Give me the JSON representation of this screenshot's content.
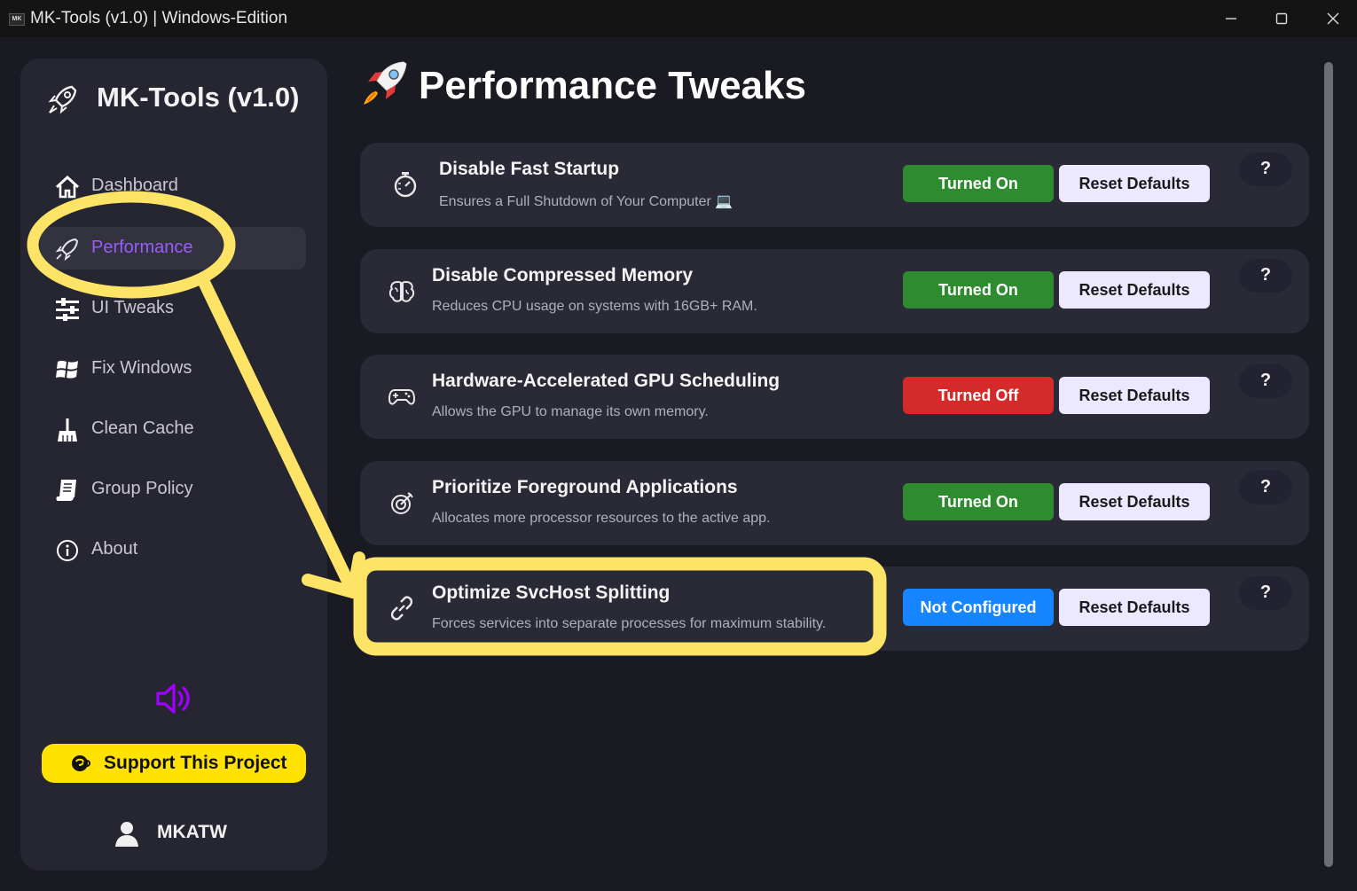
{
  "window": {
    "app_icon": "MK",
    "title": "MK-Tools (v1.0) | Windows-Edition",
    "icons": {
      "minimize": "minimize-icon",
      "maximize": "maximize-icon",
      "close": "close-icon"
    }
  },
  "sidebar": {
    "brand_icon": "rocket-icon",
    "brand": "MK-Tools (v1.0)",
    "items": [
      {
        "label": "Dashboard",
        "icon": "home-icon"
      },
      {
        "label": "Performance",
        "icon": "rocket-icon",
        "active": true
      },
      {
        "label": "UI Tweaks",
        "icon": "sliders-icon"
      },
      {
        "label": "Fix Windows",
        "icon": "windows-logo-icon"
      },
      {
        "label": "Clean Cache",
        "icon": "broom-icon"
      },
      {
        "label": "Group Policy",
        "icon": "scroll-icon"
      },
      {
        "label": "About",
        "icon": "info-icon"
      }
    ],
    "sound_icon": "speaker-icon",
    "support_label": "Support This Project",
    "support_icon": "coffee-icon",
    "user_icon": "user-icon",
    "user": "MKATW"
  },
  "main": {
    "page_icon": "rocket-icon",
    "title": "Performance Tweaks",
    "tweaks": [
      {
        "title": "Disable Fast Startup",
        "desc": "Ensures a Full Shutdown of Your Computer 💻",
        "status": "Turned On",
        "state": "on",
        "reset": "Reset Defaults",
        "help": "?",
        "icon": "stopwatch-icon"
      },
      {
        "title": "Disable Compressed Memory",
        "desc": "Reduces CPU usage on systems with 16GB+ RAM.",
        "status": "Turned On",
        "state": "on",
        "reset": "Reset Defaults",
        "help": "?",
        "icon": "brain-icon"
      },
      {
        "title": "Hardware-Accelerated GPU Scheduling",
        "desc": "Allows the GPU to manage its own memory.",
        "status": "Turned Off",
        "state": "off",
        "reset": "Reset Defaults",
        "help": "?",
        "icon": "gamepad-icon"
      },
      {
        "title": "Prioritize Foreground Applications",
        "desc": "Allocates more processor resources to the active app.",
        "status": "Turned On",
        "state": "on",
        "reset": "Reset Defaults",
        "help": "?",
        "icon": "target-icon"
      },
      {
        "title": "Optimize SvcHost Splitting",
        "desc": "Forces services into separate processes for maximum stability.",
        "status": "Not Configured",
        "state": "not-configured",
        "reset": "Reset Defaults",
        "help": "?",
        "icon": "link-icon"
      }
    ]
  },
  "colors": {
    "accent": "#9a5cff",
    "status_on": "#2e8b2f",
    "status_off": "#d42a2a",
    "status_not_configured": "#1685ff",
    "support": "#ffe200",
    "highlight": "#fde467"
  }
}
